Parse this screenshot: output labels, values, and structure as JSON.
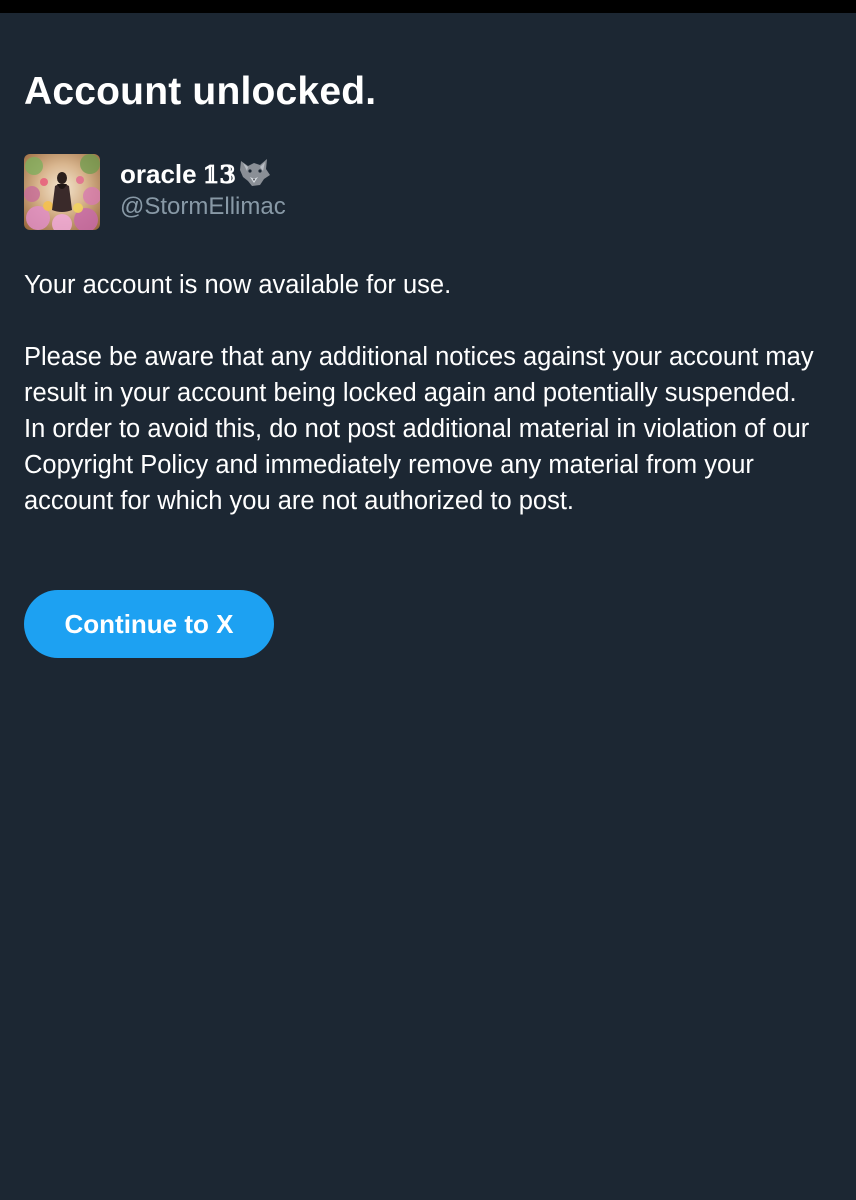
{
  "page": {
    "title": "Account unlocked.",
    "background_color": "#1c2733",
    "accent_color": "#1da1f2"
  },
  "profile": {
    "display_name": "oracle",
    "display_name_number": "𝟙𝟛",
    "display_name_emoji_icon": "wolf-icon",
    "handle": "@StormEllimac"
  },
  "messages": [
    "Your account is now available for use.",
    "Please be aware that any additional notices against your account may result in your account being locked again and potentially suspended. In order to avoid this, do not post additional material in violation of our Copyright Policy and immediately remove any material from your account for which you are not authorized to post."
  ],
  "actions": {
    "continue_label": "Continue to X"
  }
}
